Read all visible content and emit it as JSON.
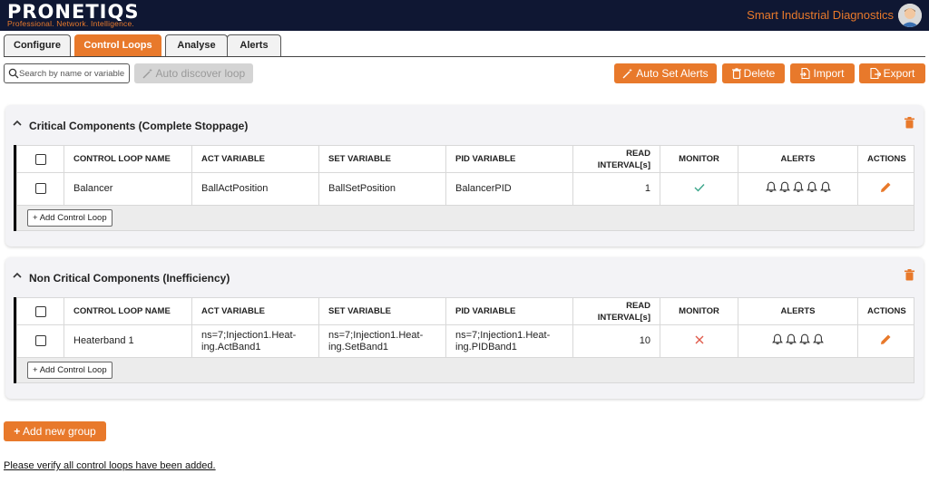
{
  "header": {
    "logo": "PRONETIQS",
    "tagline": "Professional. Network. Intelligence.",
    "app_title": "Smart Industrial Diagnostics"
  },
  "tabs": [
    {
      "label": "Configure",
      "active": false
    },
    {
      "label": "Control Loops",
      "active": true
    },
    {
      "label": "Analyse",
      "active": false
    },
    {
      "label": "Alerts",
      "active": false
    }
  ],
  "toolbar": {
    "search_placeholder": "Search by name or variable",
    "auto_discover_label": "Auto discover loop",
    "auto_set_alerts_label": "Auto Set Alerts",
    "delete_label": "Delete",
    "import_label": "Import",
    "export_label": "Export"
  },
  "columns": [
    "CONTROL LOOP NAME",
    "ACT VARIABLE",
    "SET VARIABLE",
    "PID VARIABLE",
    "READ INTERVAL[s]",
    "MONITOR",
    "ALERTS",
    "ACTIONS"
  ],
  "groups": [
    {
      "title": "Critical Components (Complete Stoppage)",
      "rows": [
        {
          "name": "Balancer",
          "act": "BallActPosition",
          "set": "BallSetPosition",
          "pid": "BalancerPID",
          "interval": "1",
          "monitor": true,
          "alerts": 5
        }
      ],
      "add_label": "Add Control Loop"
    },
    {
      "title": "Non Critical Components (Inefficiency)",
      "rows": [
        {
          "name": "Heaterband 1",
          "act": "ns=7;Injection1.Heat-ing.ActBand1",
          "set": "ns=7;Injection1.Heat-ing.SetBand1",
          "pid": "ns=7;Injection1.Heat-ing.PIDBand1",
          "interval": "10",
          "monitor": false,
          "alerts": 4
        }
      ],
      "add_label": "Add Control Loop"
    }
  ],
  "add_group_label": "Add new group",
  "verify_text": "Please verify all control loops have been added.",
  "colors": {
    "accent": "#e8792b",
    "navy": "#0f1733",
    "check": "#3aa58a",
    "cross": "#e05a4a"
  }
}
